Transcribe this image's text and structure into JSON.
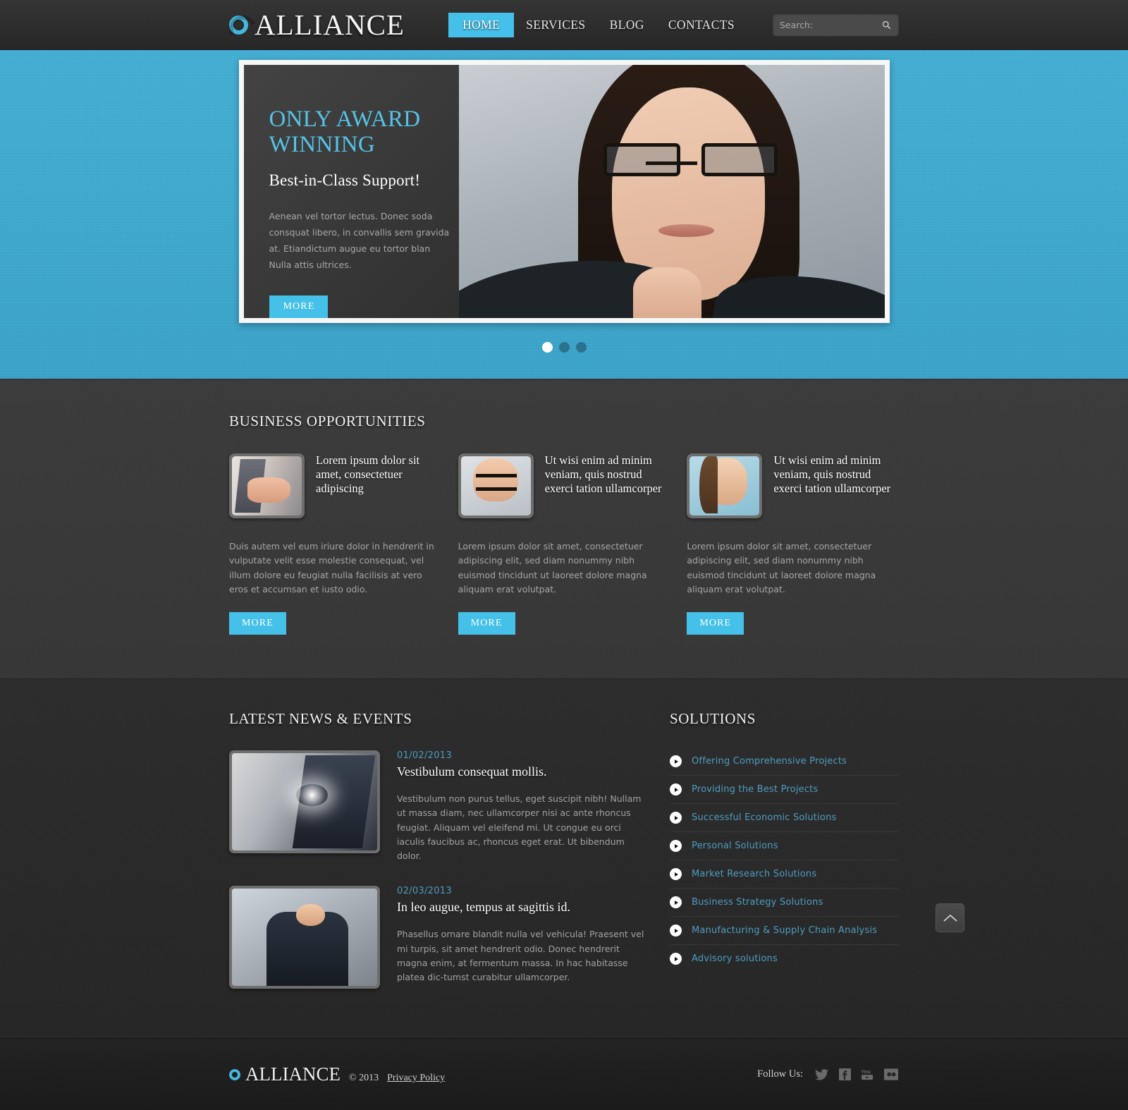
{
  "header": {
    "logo_text": "ALLIANCE",
    "logo_icon": "ring-logo-icon",
    "nav": [
      {
        "label": "HOME",
        "active": true
      },
      {
        "label": "SERVICES",
        "active": false
      },
      {
        "label": "BLOG",
        "active": false
      },
      {
        "label": "CONTACTS",
        "active": false
      }
    ],
    "search": {
      "placeholder": "Search:",
      "value": "",
      "icon": "search-icon"
    }
  },
  "hero": {
    "slide": {
      "title": "ONLY AWARD WINNING",
      "subtitle": "Best-in-Class Support!",
      "body": "Aenean vel tortor lectus. Donec soda consquat libero, in convallis sem gravida at. Etiandictum augue eu tortor blan Nulla attis ultrices.",
      "more_label": "MORE"
    },
    "pagination": {
      "count": 3,
      "active_index": 0
    }
  },
  "business": {
    "section_title": "BUSINESS OPPORTUNITIES",
    "columns": [
      {
        "image_alt": "handshake-photo",
        "title": "Lorem ipsum dolor sit amet, consectetuer adipiscing",
        "body": "Duis autem vel eum iriure dolor in hendrerit in vulputate velit esse molestie consequat, vel illum dolore eu feugiat nulla facilisis at vero eros et accumsan et iusto odio.",
        "more_label": "MORE"
      },
      {
        "image_alt": "man-with-glasses-photo",
        "title": "Ut wisi enim ad minim veniam, quis nostrud exerci tation ullamcorper",
        "body": "Lorem ipsum dolor sit amet, consectetuer adipiscing elit, sed diam nonummy nibh euismod tincidunt ut laoreet dolore magna aliquam erat volutpat.",
        "more_label": "MORE"
      },
      {
        "image_alt": "smiling-woman-photo",
        "title": "Ut wisi enim ad minim veniam, quis nostrud exerci tation ullamcorper",
        "body": "Lorem ipsum dolor sit amet, consectetuer adipiscing elit, sed diam nonummy nibh euismod tincidunt ut laoreet dolore magna aliquam erat volutpat.",
        "more_label": "MORE"
      }
    ]
  },
  "news": {
    "section_title": "LATEST NEWS & EVENTS",
    "items": [
      {
        "date": "01/02/2013",
        "title": "Vestibulum consequat mollis.",
        "body": "Vestibulum non purus tellus, eget suscipit nibh! Nullam ut massa diam, nec ullamcorper nisi ac ante rhoncus feugiat. Aliquam vel eleifend mi. Ut congue eu orci iaculis faucibus ac, rhoncus eget erat. Ut bibendum dolor.",
        "image_alt": "touchscreen-photo"
      },
      {
        "date": "02/03/2013",
        "title": "In leo augue, tempus at sagittis id.",
        "body": "Phasellus ornare blandit nulla vel vehicula! Praesent vel mi turpis, sit amet hendrerit odio. Donec hendrerit magna enim, at fermentum massa. In hac habitasse platea dic-tumst curabitur ullamcorper.",
        "image_alt": "celebrating-businessman-photo"
      }
    ]
  },
  "solutions": {
    "section_title": "SOLUTIONS",
    "items": [
      "Offering Comprehensive Projects",
      "Providing the Best Projects",
      "Successful Economic Solutions",
      "Personal Solutions",
      "Market Research Solutions",
      "Business Strategy Solutions",
      "Manufacturing & Supply Chain Analysis",
      "Advisory solutions"
    ]
  },
  "to_top": {
    "icon": "chevron-up-icon"
  },
  "footer": {
    "logo_text": "ALLIANCE",
    "copyright": "© 2013",
    "privacy_label": "Privacy Policy",
    "follow_label": "Follow Us:",
    "social": [
      {
        "name": "twitter-icon"
      },
      {
        "name": "facebook-icon"
      },
      {
        "name": "youtube-icon"
      },
      {
        "name": "flickr-icon"
      }
    ]
  },
  "colors": {
    "accent": "#45c0e8",
    "hero_bg": "#3fa9ce",
    "link": "#4e9cc0",
    "dark_bg": "#2a2a2a"
  }
}
